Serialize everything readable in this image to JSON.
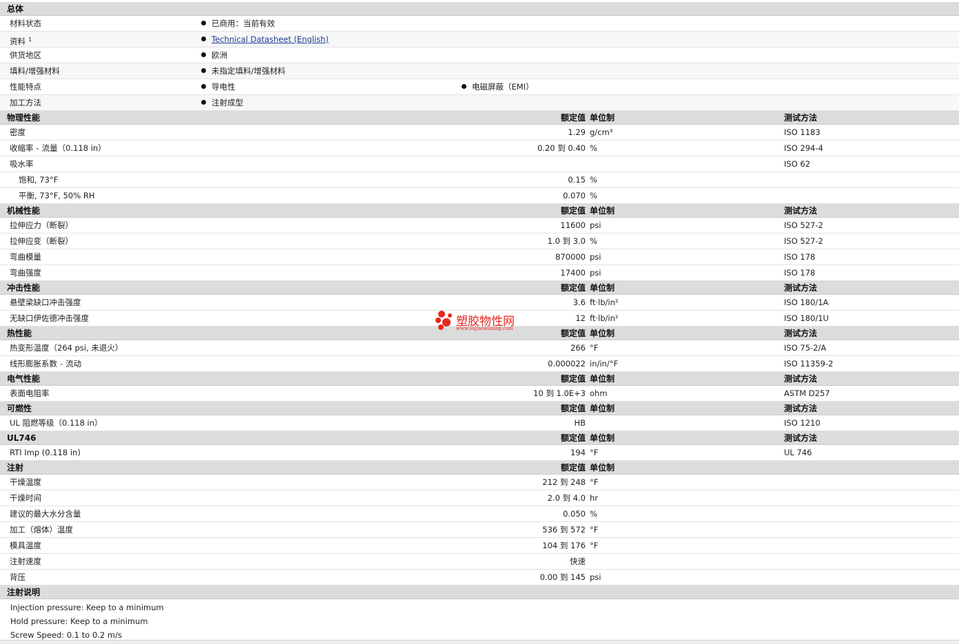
{
  "general": {
    "title": "总体",
    "material_status": {
      "label": "材料状态",
      "value": "已商用：当前有效"
    },
    "documents": {
      "label": "资料",
      "footnote": "1",
      "link_text": "Technical Datasheet (English)"
    },
    "region": {
      "label": "供货地区",
      "value": "欧洲"
    },
    "filler": {
      "label": "填料/增强材料",
      "value": "未指定填料/增强材料"
    },
    "features": {
      "label": "性能特点",
      "value1": "导电性",
      "value2": "电磁屏蔽（EMI）"
    },
    "processing": {
      "label": "加工方法",
      "value": "注射成型"
    }
  },
  "headers": {
    "nominal": "额定值",
    "unit": "单位制",
    "test": "测试方法"
  },
  "physical": {
    "title": "物理性能",
    "rows": [
      {
        "label": "密度",
        "value": "1.29",
        "unit": "g/cm³",
        "test": "ISO 1183"
      },
      {
        "label": "收缩率",
        "cond": "流量（0.118 in）",
        "value": "0.20 到  0.40",
        "unit": "%",
        "test": "ISO 294-4"
      },
      {
        "label": "吸水率",
        "value": "",
        "unit": "",
        "test": "ISO 62"
      },
      {
        "label": "饱和, 73°F",
        "value": "0.15",
        "unit": "%",
        "test": ""
      },
      {
        "label": "平衡, 73°F, 50% RH",
        "value": "0.070",
        "unit": "%",
        "test": ""
      }
    ]
  },
  "mechanical": {
    "title": "机械性能",
    "rows": [
      {
        "label": "拉伸应力（断裂）",
        "value": "11600",
        "unit": "psi",
        "test": "ISO 527-2"
      },
      {
        "label": "拉伸应变（断裂）",
        "value": "1.0 到  3.0",
        "unit": "%",
        "test": "ISO 527-2"
      },
      {
        "label": "弯曲模量",
        "value": "870000",
        "unit": "psi",
        "test": "ISO 178"
      },
      {
        "label": "弯曲强度",
        "value": "17400",
        "unit": "psi",
        "test": "ISO 178"
      }
    ]
  },
  "impact": {
    "title": "冲击性能",
    "rows": [
      {
        "label": "悬壁梁缺口冲击强度",
        "value": "3.6",
        "unit": "ft·lb/in²",
        "test": "ISO 180/1A"
      },
      {
        "label": "无缺口伊佐德冲击强度",
        "value": "12",
        "unit": "ft·lb/in²",
        "test": "ISO 180/1U"
      }
    ]
  },
  "thermal": {
    "title": "热性能",
    "rows": [
      {
        "label": "热变形温度（264 psi, 未退火）",
        "value": "266",
        "unit": "°F",
        "test": "ISO 75-2/A"
      },
      {
        "label": "线形膨胀系数",
        "cond": "流动",
        "value": "0.000022",
        "unit": "in/in/°F",
        "test": "ISO 11359-2"
      }
    ]
  },
  "electrical": {
    "title": "电气性能",
    "rows": [
      {
        "label": "表面电阻率",
        "value": "10 到  1.0E+3",
        "unit": "ohm",
        "test": "ASTM D257"
      }
    ]
  },
  "flammability": {
    "title": "可燃性",
    "rows": [
      {
        "label": "UL 阻燃等级（0.118 in）",
        "value": "HB",
        "unit": "",
        "test": "ISO 1210"
      }
    ]
  },
  "ul746": {
    "title": "UL746",
    "rows": [
      {
        "label": "RTI Imp (0.118 in)",
        "value": "194",
        "unit": "°F",
        "test": "UL 746"
      }
    ]
  },
  "injection": {
    "title": "注射",
    "rows": [
      {
        "label": "干燥温度",
        "value": "212 到  248",
        "unit": "°F"
      },
      {
        "label": "干燥时间",
        "value": "2.0 到  4.0",
        "unit": "hr"
      },
      {
        "label": "建议的最大水分含量",
        "value": "0.050",
        "unit": "%"
      },
      {
        "label": "加工（熔体）温度",
        "value": "536 到  572",
        "unit": "°F"
      },
      {
        "label": "模具温度",
        "value": "104 到  176",
        "unit": "°F"
      },
      {
        "label": "注射速度",
        "value": "快速",
        "unit": ""
      },
      {
        "label": "背压",
        "value": "0.00 到  145",
        "unit": "psi"
      }
    ]
  },
  "notes": {
    "title": "注射说明",
    "lines": [
      "Injection pressure: Keep to a minimum",
      "Hold pressure: Keep to a minimum",
      "Screw Speed: 0.1 to 0.2 m/s"
    ]
  },
  "watermark": {
    "title": "塑胶物性网",
    "subtitle": "www.sujiaowuxing.com",
    "color": "#e8281f"
  }
}
